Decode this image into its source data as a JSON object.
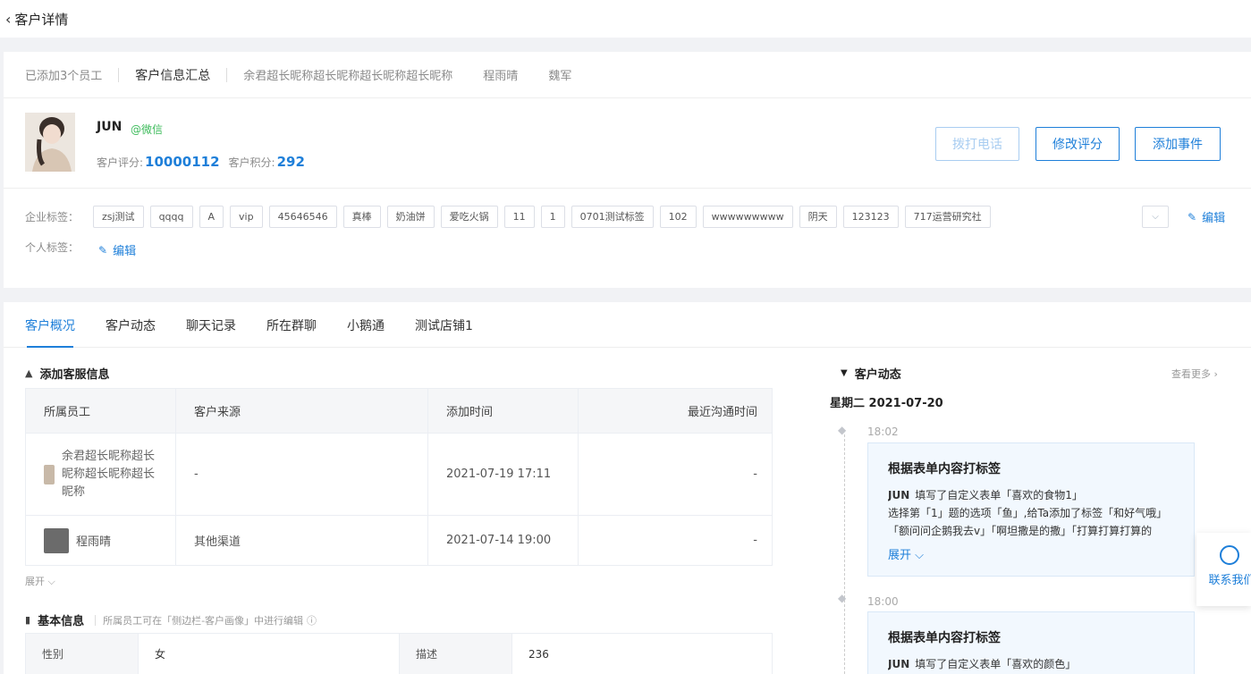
{
  "header": {
    "back_icon": "‹",
    "title": "客户详情"
  },
  "employee_tabs": {
    "count_label": "已添加3个员工",
    "items": [
      "客户信息汇总",
      "余君超长昵称超长昵称超长昵称超长昵称",
      "程雨晴",
      "魏军"
    ]
  },
  "customer": {
    "name": "JUN",
    "source": "@微信",
    "score_label": "客户评分:",
    "score": "10000112",
    "points_label": "客户积分:",
    "points": "292"
  },
  "actions": {
    "call": "拨打电话",
    "edit_score": "修改评分",
    "add_event": "添加事件"
  },
  "tags": {
    "corp_label": "企业标签：",
    "personal_label": "个人标签：",
    "edit_label": "编辑",
    "corp": [
      "zsj测试",
      "qqqq",
      "A",
      "vip",
      "45646546",
      "真棒",
      "奶油饼",
      "爱吃火锅",
      "11",
      "1",
      "0701测试标签",
      "102",
      "wwwwwwwww",
      "阴天",
      "123123",
      "717运营研究社"
    ]
  },
  "main_tabs": [
    "客户概况",
    "客户动态",
    "聊天记录",
    "所在群聊",
    "小鹅通",
    "测试店铺1"
  ],
  "service_info": {
    "title": "添加客服信息",
    "columns": [
      "所属员工",
      "客户来源",
      "添加时间",
      "最近沟通时间"
    ],
    "rows": [
      {
        "employee_line1": "余君超长昵称超长",
        "employee_line2": "昵称超长昵称超长",
        "employee_line3": "昵称",
        "source": "-",
        "added": "2021-07-19 17:11",
        "last": "-"
      },
      {
        "employee": "程雨晴",
        "source": "其他渠道",
        "added": "2021-07-14 19:00",
        "last": "-"
      }
    ],
    "expand": "展开"
  },
  "basic_info": {
    "title": "基本信息",
    "hint": "所属员工可在「侧边栏-客户画像」中进行编辑",
    "gender_label": "性别",
    "gender": "女",
    "desc_label": "描述",
    "desc": "236"
  },
  "feed": {
    "title": "客户动态",
    "see_more": "查看更多",
    "date": "星期二 2021-07-20",
    "events": [
      {
        "time": "18:02",
        "title": "根据表单内容打标签",
        "actor": "JUN",
        "line1": "填写了自定义表单「喜欢的食物1」",
        "line2": "选择第「1」题的选项「鱼」,给Ta添加了标签「和好气哦」",
        "line3": "「额问问企鹅我去v」「啊坦撒是的撒」「打算打算打算的",
        "more": "展开"
      },
      {
        "time": "18:00",
        "title": "根据表单内容打标签",
        "actor": "JUN",
        "line1": "填写了自定义表单「喜欢的颜色」"
      }
    ]
  },
  "contact": {
    "label": "联系我们"
  },
  "colors": {
    "primary": "#1e7fd9",
    "wechat_green": "#3dbb5b"
  }
}
